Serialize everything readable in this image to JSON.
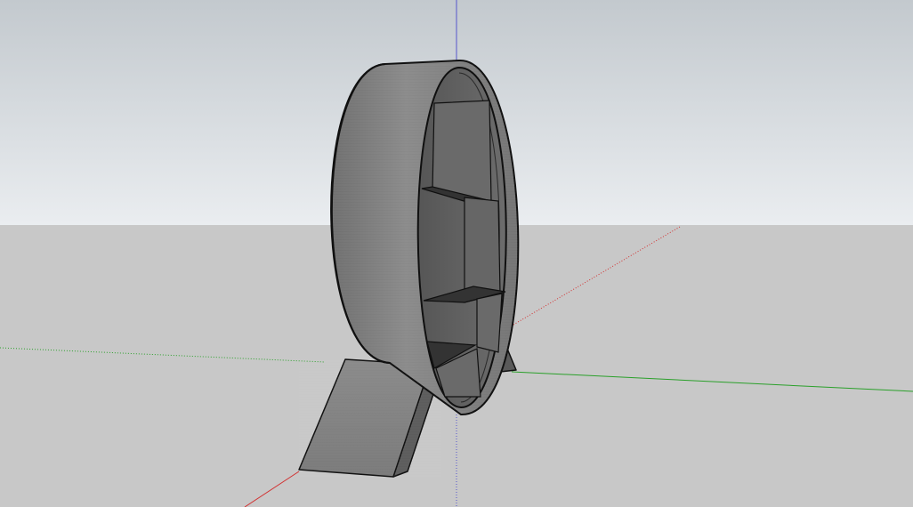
{
  "viewport": {
    "sky_top_color": "#c3c9ce",
    "sky_bottom_color": "#eaedf0",
    "ground_color": "#c8c8c8",
    "axis_colors": {
      "red": "#d23030",
      "green": "#2aa02a",
      "blue": "#5555cc"
    },
    "model": {
      "name": "ring-shelf-with-ramp",
      "face_color": "#7a7a7a",
      "inner_color": "#5c5c5c",
      "shelf_color": "#3a3a3a",
      "edge_color": "#101010"
    }
  }
}
